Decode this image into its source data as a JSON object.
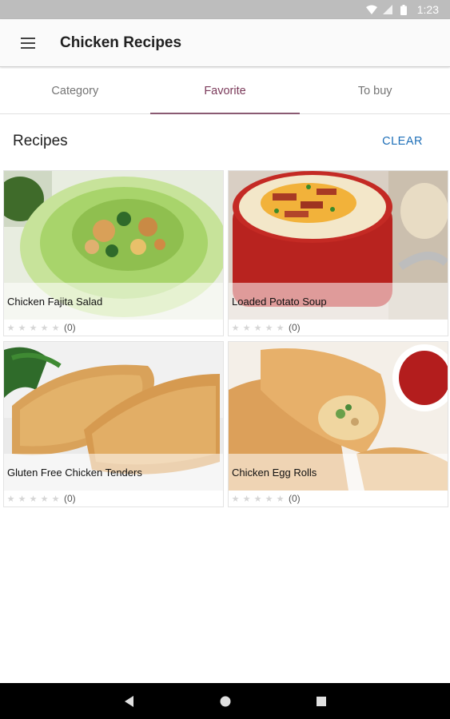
{
  "status_bar": {
    "time": "1:23",
    "icons": [
      "wifi-icon",
      "signal-icon",
      "battery-icon"
    ]
  },
  "app_bar": {
    "title": "Chicken Recipes",
    "menu_icon": "hamburger-menu-icon"
  },
  "tabs": [
    {
      "label": "Category",
      "active": false
    },
    {
      "label": "Favorite",
      "active": true
    },
    {
      "label": "To buy",
      "active": false
    }
  ],
  "section": {
    "title": "Recipes",
    "clear_label": "CLEAR"
  },
  "recipes": [
    {
      "name": "Chicken Fajita Salad",
      "rating": 0,
      "rating_count": "(0)"
    },
    {
      "name": "Loaded Potato Soup",
      "rating": 0,
      "rating_count": "(0)"
    },
    {
      "name": "Gluten Free Chicken Tenders",
      "rating": 0,
      "rating_count": "(0)"
    },
    {
      "name": "Chicken Egg Rolls",
      "rating": 0,
      "rating_count": "(0)"
    }
  ],
  "nav_bar": {
    "icons": [
      "back-icon",
      "home-icon",
      "recents-icon"
    ]
  },
  "colors": {
    "accent": "#7b3a5a",
    "clear": "#1e6fb8",
    "status_bar": "#bdbdbd"
  }
}
